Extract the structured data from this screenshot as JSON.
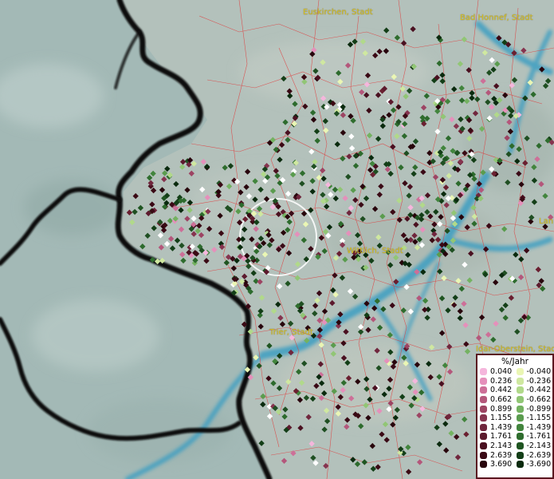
{
  "cities": [
    {
      "label": "Euskirchen, Stadt"
    },
    {
      "label": "Bad Honnef, Stadt"
    },
    {
      "label": "Wittlich, Stadt"
    },
    {
      "label": "Trier, Stadt"
    },
    {
      "label": "Idar-Oberstein, Stadt"
    },
    {
      "label": "Lan"
    }
  ],
  "legend": {
    "title": "%/Jahr",
    "positive": [
      {
        "label": "0.040",
        "color": "#f5b6dc"
      },
      {
        "label": "0.236",
        "color": "#e590bb"
      },
      {
        "label": "0.442",
        "color": "#cd6f98"
      },
      {
        "label": "0.662",
        "color": "#b4577b"
      },
      {
        "label": "0.899",
        "color": "#9d4463"
      },
      {
        "label": "1.155",
        "color": "#86344f"
      },
      {
        "label": "1.439",
        "color": "#70263d"
      },
      {
        "label": "1.761",
        "color": "#5c1a2d"
      },
      {
        "label": "2.143",
        "color": "#4a1020"
      },
      {
        "label": "2.639",
        "color": "#3a0915"
      },
      {
        "label": "3.690",
        "color": "#28040c"
      }
    ],
    "negative": [
      {
        "label": "-0.040",
        "color": "#eaf6b4"
      },
      {
        "label": "-0.236",
        "color": "#cfe8a0"
      },
      {
        "label": "-0.442",
        "color": "#b1d98a"
      },
      {
        "label": "-0.662",
        "color": "#91c675"
      },
      {
        "label": "-0.899",
        "color": "#74b261"
      },
      {
        "label": "-1.155",
        "color": "#5a9c4e"
      },
      {
        "label": "-1.439",
        "color": "#42853d"
      },
      {
        "label": "-1.761",
        "color": "#2f6d2e"
      },
      {
        "label": "-2.143",
        "color": "#1f5521"
      },
      {
        "label": "-2.639",
        "color": "#133e17"
      },
      {
        "label": "-3.690",
        "color": "#0a2a0e"
      }
    ]
  },
  "colors": {
    "border": "#0b0b0b",
    "district_lines": "#e03a3a",
    "rivers": "#3a9ec2",
    "highlight_circle": "#ffffff",
    "background_left": "#9fb7b4",
    "background_right": "#b6c3bd"
  }
}
